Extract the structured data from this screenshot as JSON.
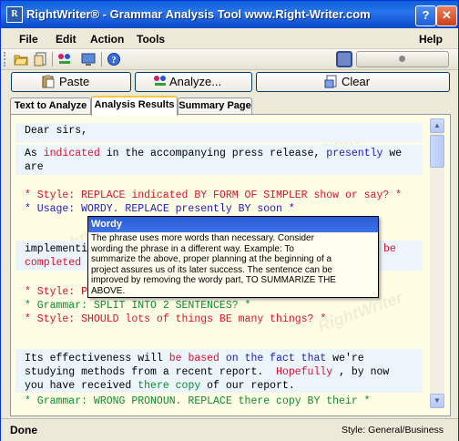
{
  "window": {
    "title": "RightWriter® - Grammar Analysis Tool www.Right-Writer.com",
    "help_button": "?",
    "close_button": "✕"
  },
  "menu": [
    "File",
    "Edit",
    "Action",
    "Tools",
    "Help"
  ],
  "toolbar": {
    "icons": [
      "open-folder-icon",
      "document-icon",
      "analyze-icon",
      "monitor-icon",
      "info-icon"
    ],
    "colors": {
      "accent": "#0a5fd8",
      "tab_highlight": "#ffc83c"
    }
  },
  "buttons": {
    "paste": "Paste",
    "analyze": "Analyze...",
    "clear": "Clear"
  },
  "tabs": [
    "Text to Analyze",
    "Analysis Results",
    "Summary Page"
  ],
  "active_tab": "Analysis Results",
  "content": {
    "greeting": "Dear sirs,",
    "p1_a": "As ",
    "p1_b": "indicated",
    "p1_c": " in the accompanying press release, ",
    "p1_d": "presently",
    "p1_e": " we",
    "p1_f": "are",
    "style1": "* Style: REPLACE indicated BY FORM OF SIMPLER show or say? *",
    "usage1": "* Usage: WORDY. REPLACE presently BY soon *",
    "p2_a": "implementin",
    "p2_b": "be",
    "p2_c": "completed",
    "style2": "* Style: P",
    "grammar1": "* Grammar: SPLIT INTO 2 SENTENCES? *",
    "style3": "* Style: SHOULD lots of things BE many things? *",
    "p3_a": "Its effectiveness will ",
    "p3_b": "be based",
    "p3_c": " ",
    "p3_d": "on the fact that",
    "p3_e": " we're",
    "p3_f": "studying methods from a recent report.  ",
    "p3_g": "Hopefully",
    "p3_h": " , by now",
    "p3_i": "you have received ",
    "p3_j": "there copy",
    "p3_k": " of our report.",
    "grammar2": "* Grammar: WRONG PRONOUN. REPLACE there copy BY their *"
  },
  "tooltip": {
    "title": "Wordy",
    "lines": [
      "The phrase uses more words than necessary. Consider",
      "wording the phrase in a different way. Example: To",
      "summarize the above, proper planning at the beginning of a",
      "project assures us of its later success. The sentence can be",
      "improved by removing the wordy part, TO SUMMARIZE THE",
      "ABOVE."
    ]
  },
  "status": {
    "left": "Done",
    "right": "Style:  General/Business"
  }
}
